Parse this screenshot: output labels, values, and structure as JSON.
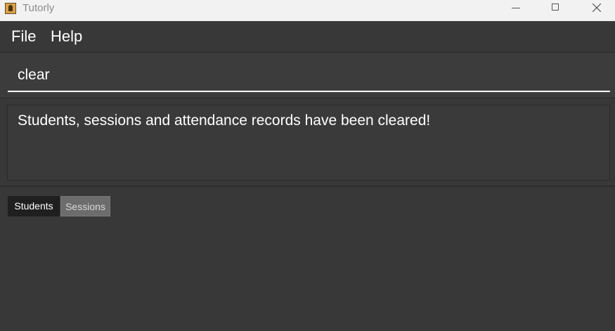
{
  "window": {
    "title": "Tutorly",
    "icon": "contact-book-icon"
  },
  "menu": {
    "items": [
      {
        "label": "File"
      },
      {
        "label": "Help"
      }
    ]
  },
  "command_box": {
    "value": "clear",
    "placeholder": ""
  },
  "result_display": {
    "message": "Students, sessions and attendance records have been cleared!"
  },
  "tabs": [
    {
      "label": "Students",
      "selected": true
    },
    {
      "label": "Sessions",
      "selected": false
    }
  ],
  "colors": {
    "background": "#383838",
    "titlebar": "#f2f2f2",
    "selected_tab": "#1f1f1f",
    "unselected_tab": "#6c6c6c",
    "text": "#ffffff"
  }
}
